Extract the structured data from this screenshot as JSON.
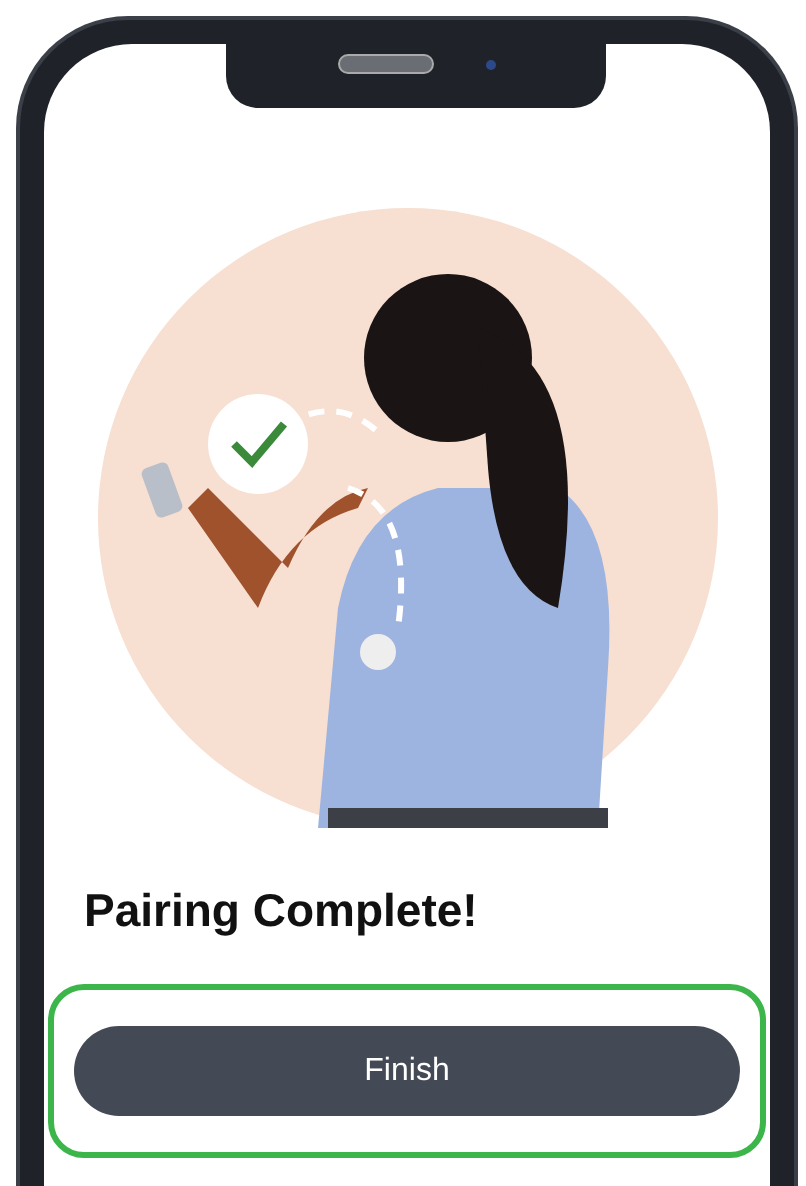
{
  "screen": {
    "title": "Pairing Complete!",
    "button": {
      "label": "Finish",
      "highlighted": true
    }
  }
}
